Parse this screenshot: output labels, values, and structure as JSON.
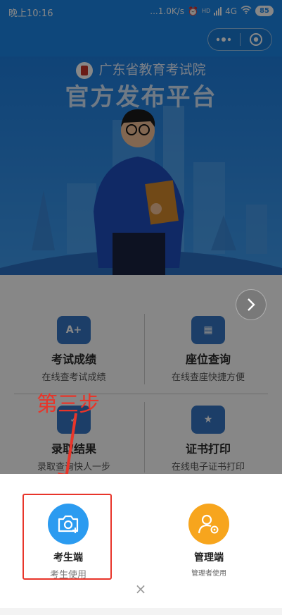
{
  "status_bar": {
    "time": "晚上10:16",
    "net_speed": "...1.0K/s",
    "network": "4G",
    "hd": "HD",
    "battery": "85"
  },
  "capsule": {
    "more_icon": "more-dots-icon",
    "close_icon": "target-icon"
  },
  "hero": {
    "brand": "广东省教育考试院",
    "title": "官方发布平台"
  },
  "menu": {
    "items": [
      {
        "title": "考试成绩",
        "sub": "在线查考试成绩",
        "icon_text": "A+"
      },
      {
        "title": "座位查询",
        "sub": "在线查座快捷方便",
        "icon_text": "▦"
      },
      {
        "title": "录取结果",
        "sub": "录取查询快人一步",
        "icon_text": "✓"
      },
      {
        "title": "证书打印",
        "sub": "在线电子证书打印",
        "icon_text": "★"
      }
    ]
  },
  "annotation": {
    "step": "第三步"
  },
  "sheet": {
    "options": [
      {
        "title": "考生端",
        "sub": "考生使用",
        "color": "#2b9bf0",
        "icon": "camera-icon"
      },
      {
        "title": "管理端",
        "sub": "管理者使用",
        "color": "#f7a51d",
        "icon": "admin-gear-icon"
      }
    ],
    "close": "×"
  }
}
